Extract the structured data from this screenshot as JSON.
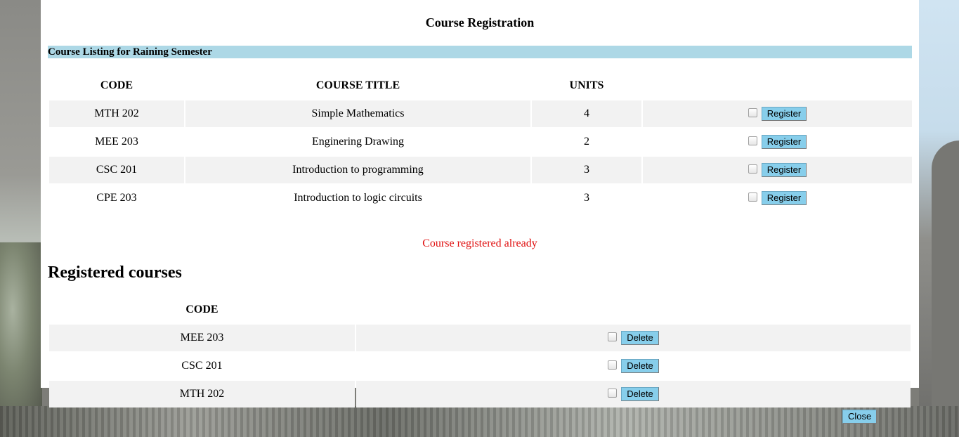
{
  "page_title": "Course Registration",
  "listing_header": "Course Listing for Raining Semester",
  "courses_table": {
    "headers": {
      "code": "CODE",
      "title": "COURSE TITLE",
      "units": "UNITS"
    },
    "rows": [
      {
        "code": "MTH 202",
        "title": "Simple Mathematics",
        "units": "4",
        "action": "Register"
      },
      {
        "code": "MEE 203",
        "title": "Enginering Drawing",
        "units": "2",
        "action": "Register"
      },
      {
        "code": "CSC 201",
        "title": "Introduction to programming",
        "units": "3",
        "action": "Register"
      },
      {
        "code": "CPE 203",
        "title": "Introduction to logic circuits",
        "units": "3",
        "action": "Register"
      }
    ]
  },
  "status_message": "Course registered already",
  "registered_title": "Registered courses",
  "registered_table": {
    "headers": {
      "code": "CODE"
    },
    "rows": [
      {
        "code": "MEE 203",
        "action": "Delete"
      },
      {
        "code": "CSC 201",
        "action": "Delete"
      },
      {
        "code": "MTH 202",
        "action": "Delete"
      }
    ]
  },
  "close_label": "Close",
  "colors": {
    "section_bar": "#add8e6",
    "button": "#87ceeb",
    "status_text": "#e01010",
    "row_shade": "#f2f2f2"
  }
}
